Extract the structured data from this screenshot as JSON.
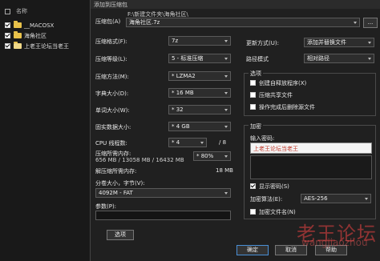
{
  "explorer": {
    "header": "名称",
    "items": [
      {
        "name": "__MACOSX",
        "checked": true
      },
      {
        "name": "海角社区",
        "checked": true
      },
      {
        "name": "上老王论坛当老王",
        "checked": true
      }
    ]
  },
  "dialog": {
    "title": "添加到压缩包",
    "archive": {
      "label": "压缩包(A)",
      "path": "F:\\新建文件夹\\海角社区\\",
      "name": "海角社区.7z"
    },
    "format": {
      "label": "压缩格式(F):",
      "value": "7z"
    },
    "level": {
      "label": "压缩等级(L):",
      "value": "5 - 标准压缩"
    },
    "method": {
      "label": "压缩方法(M):",
      "value": "* LZMA2"
    },
    "dict": {
      "label": "字典大小(D):",
      "value": "* 16 MB"
    },
    "word": {
      "label": "单词大小(W):",
      "value": "* 32"
    },
    "solid": {
      "label": "固实数据大小:",
      "value": "* 4 GB"
    },
    "threads": {
      "label": "CPU 线程数:",
      "value": "* 4",
      "max": "/ 8"
    },
    "memory": {
      "label": "压缩所需内存:",
      "detail": "656 MB / 13058 MB / 16432 MB",
      "value": "* 80%"
    },
    "decomp": {
      "label": "解压缩所需内存:",
      "value": "18 MB"
    },
    "split": {
      "label": "分卷大小，字节(V):",
      "value": "4092M - FAT"
    },
    "params": {
      "label": "参数(P):",
      "value": ""
    },
    "options_button": "选项",
    "update_mode": {
      "label": "更新方式(U):",
      "value": "添加并替换文件"
    },
    "path_mode": {
      "label": "路径模式",
      "value": "相对路径"
    },
    "options": {
      "title": "选项",
      "items": [
        {
          "label": "创建自释放程序(X)",
          "checked": false
        },
        {
          "label": "压缩共享文件",
          "checked": false
        },
        {
          "label": "操作完成后删除源文件",
          "checked": false
        }
      ]
    },
    "encryption": {
      "title": "加密",
      "password_label": "输入密码:",
      "password_value": "上老王论坛当老王",
      "show_password": {
        "label": "显示密码(S)",
        "checked": true
      },
      "method_label": "加密算法(E):",
      "method_value": "AES-256",
      "encrypt_names": {
        "label": "加密文件名(N)",
        "checked": false
      }
    },
    "buttons": {
      "ok": "确定",
      "cancel": "取消",
      "help": "帮助"
    }
  },
  "watermark": {
    "main": "老王论坛",
    "sub": "wangjiaozhou"
  }
}
